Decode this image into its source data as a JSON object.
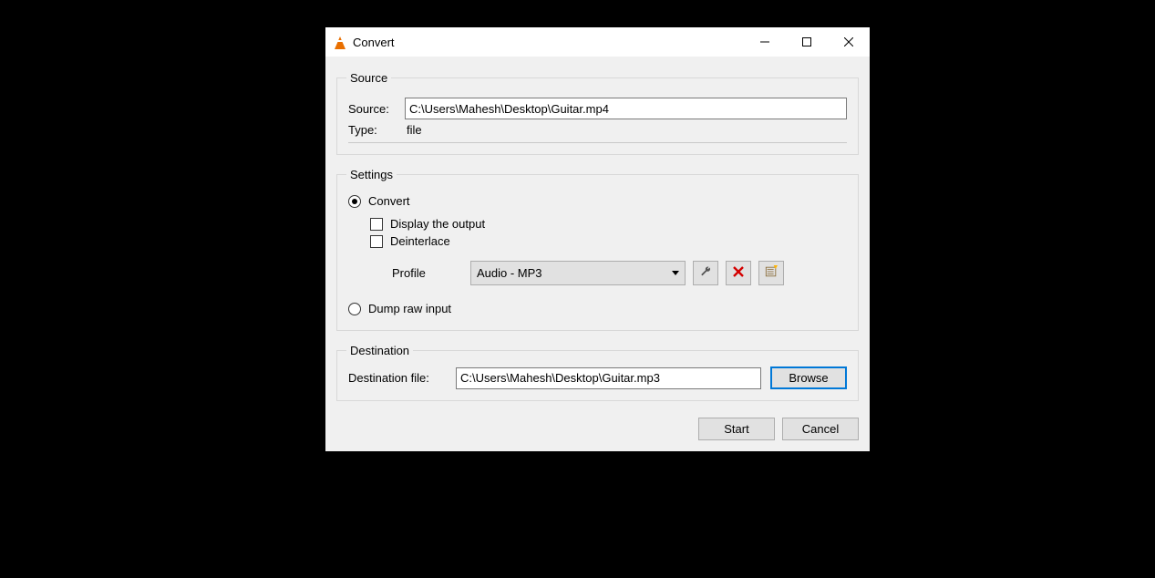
{
  "window": {
    "title": "Convert"
  },
  "source_group": {
    "legend": "Source",
    "source_label": "Source:",
    "source_value": "C:\\Users\\Mahesh\\Desktop\\Guitar.mp4",
    "type_label": "Type:",
    "type_value": "file"
  },
  "settings_group": {
    "legend": "Settings",
    "convert_label": "Convert",
    "display_output_label": "Display the output",
    "deinterlace_label": "Deinterlace",
    "profile_label": "Profile",
    "profile_value": "Audio - MP3",
    "dump_raw_label": "Dump raw input"
  },
  "destination_group": {
    "legend": "Destination",
    "dest_label": "Destination file:",
    "dest_value": "C:\\Users\\Mahesh\\Desktop\\Guitar.mp3",
    "browse_label": "Browse"
  },
  "footer": {
    "start_label": "Start",
    "cancel_label": "Cancel"
  }
}
